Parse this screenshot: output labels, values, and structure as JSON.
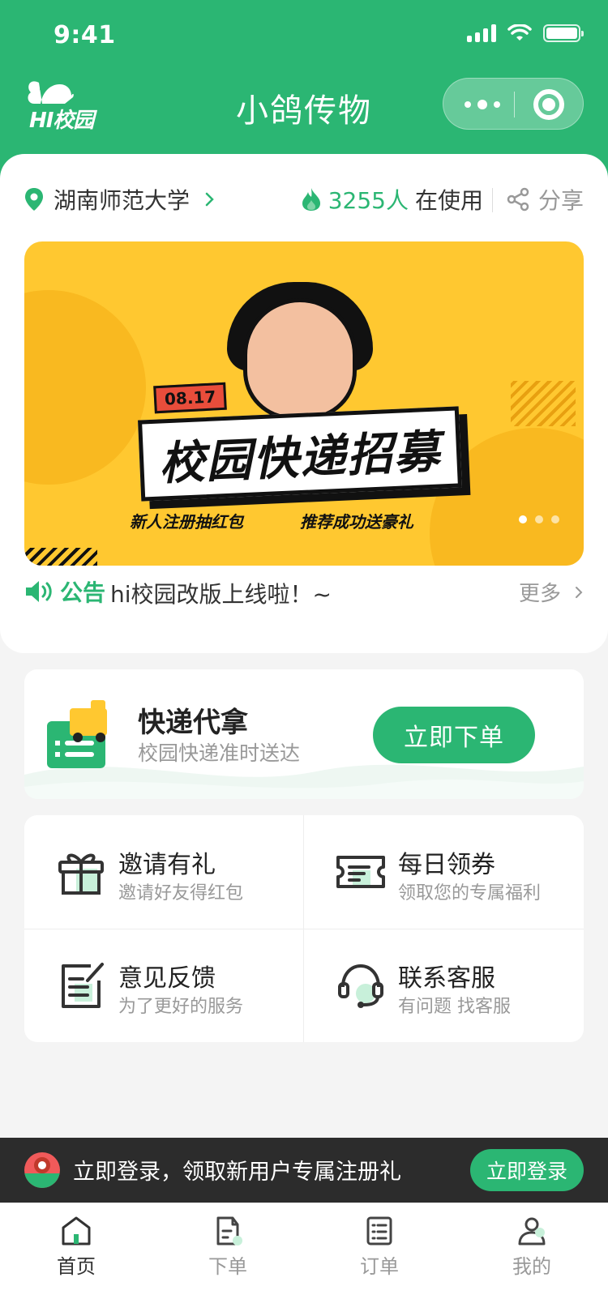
{
  "status_bar": {
    "time": "9:41"
  },
  "header": {
    "logo_text": "HI校园",
    "title": "小鸽传物"
  },
  "location": {
    "school": "湖南师范大学",
    "users_count": "3255人",
    "users_suffix": "在使用",
    "share_label": "分享"
  },
  "banner": {
    "date": "08.17",
    "title": "校园快递招募",
    "sub1": "新人注册抽红包",
    "sub2": "推荐成功送豪礼",
    "pages": 3,
    "active_page": 1
  },
  "notice": {
    "label": "公告",
    "message": "hi校园改版上线啦！~",
    "more_label": "更多"
  },
  "express": {
    "title": "快递代拿",
    "subtitle": "校园快递准时送达",
    "button_label": "立即下单"
  },
  "services": [
    {
      "icon": "gift-icon",
      "title": "邀请有礼",
      "desc": "邀请好友得红包"
    },
    {
      "icon": "coupon-icon",
      "title": "每日领券",
      "desc": "领取您的专属福利"
    },
    {
      "icon": "feedback-icon",
      "title": "意见反馈",
      "desc": "为了更好的服务"
    },
    {
      "icon": "headset-icon",
      "title": "联系客服",
      "desc": "有问题 找客服"
    }
  ],
  "login_bar": {
    "text": "立即登录，领取新用户专属注册礼",
    "button_label": "立即登录"
  },
  "tabs": [
    {
      "icon": "home-icon",
      "label": "首页",
      "active": true
    },
    {
      "icon": "order-create-icon",
      "label": "下单",
      "active": false
    },
    {
      "icon": "order-list-icon",
      "label": "订单",
      "active": false
    },
    {
      "icon": "user-icon",
      "label": "我的",
      "active": false
    }
  ],
  "colors": {
    "brand": "#2bb673",
    "banner_bg": "#ffc830",
    "dark_bar": "#2c2c2c"
  }
}
